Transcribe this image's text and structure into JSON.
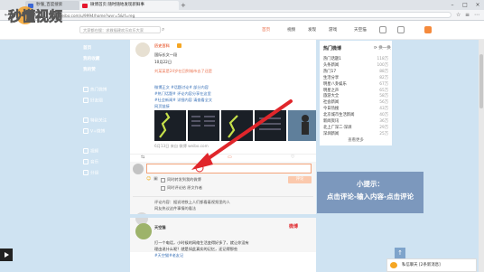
{
  "browser": {
    "tabs": [
      {
        "label": "秒懂_百度搜索"
      },
      {
        "label": "微博首页 随时随地发现新鲜事"
      }
    ],
    "new_tab": "+",
    "url": "weibo.com/u/9994/home?wvr=5&lf=reg"
  },
  "logo": {
    "text": "秒懂视频"
  },
  "site_header": {
    "search_placeholder": "大家都在搜：求救福建欢乐欢乐大家",
    "nav": [
      "首页",
      "视频",
      "发现",
      "游戏"
    ],
    "user": "天空猫"
  },
  "left_nav": [
    {
      "label": "首页",
      "bold": true
    },
    {
      "label": "我的收藏",
      "bold": true
    },
    {
      "label": "我的赞",
      "bold": true
    },
    {
      "label": "热门微博",
      "bold": false
    },
    {
      "label": "好友圈",
      "bold": false
    },
    {
      "label": "特别关注",
      "bold": false
    },
    {
      "label": "V+微博",
      "bold": false
    },
    {
      "label": "视频",
      "bold": false
    },
    {
      "label": "音乐",
      "bold": false
    },
    {
      "label": "分组",
      "bold": false
    }
  ],
  "post": {
    "author": "历史百科",
    "lines": [
      "国际长文一段",
      "10月22日",
      "刘某某是24岁在回到城市去了还是",
      "微博正文 #话题讨论# 部分内容",
      "#热门话题# 评论内容分享在这里",
      "#社会新闻# 详细内容 请查看全文",
      "网页链接"
    ],
    "source": "6月13日 来自 微博 weibo.com"
  },
  "comment": {
    "send_label": "评论",
    "option1": "同时转发到我的微博",
    "option2": "同时评论给 原文作者",
    "sample_lines": [
      "评论内容：据说地铁上人们都看着视频里的人",
      "网友热议这件事情的看法"
    ]
  },
  "post2": {
    "author": "天空猫",
    "lines": [
      "打一个电话，小时候的网络生活变得好多了，就让你没有",
      "理由说什么呢？就是如此真实的记忆，还记得那些",
      "#天空猫#老友记"
    ]
  },
  "hot": {
    "title": "热门微博",
    "more": "查看更多",
    "items": [
      {
        "text": "热门话题1",
        "value": "118万"
      },
      {
        "text": "头条新闻",
        "value": "100万"
      },
      {
        "text": "热门17",
        "value": "88万"
      },
      {
        "text": "生活分享",
        "value": "82万"
      },
      {
        "text": "明星八卦娱乐",
        "value": "67万"
      },
      {
        "text": "明星之声",
        "value": "65万"
      },
      {
        "text": "旅游大全",
        "value": "58万"
      },
      {
        "text": "社会新闻",
        "value": "56万"
      },
      {
        "text": "今日热搜",
        "value": "43万"
      },
      {
        "text": "北京城市生活新闻",
        "value": "40万"
      },
      {
        "text": "新闻资讯",
        "value": "36万"
      },
      {
        "text": "北上广深二·深圳",
        "value": "29万"
      },
      {
        "text": "深圳新闻",
        "value": "25万"
      }
    ]
  },
  "tip": {
    "line1": "小提示：",
    "line2": "点击评论-输入内容-点击评论"
  },
  "message_panel": {
    "label": "私信聊天 [2条新消息]"
  },
  "colors": {
    "accent": "#eb7350",
    "link": "#3a72b8",
    "tip_bg": "#7c98bd",
    "arrow": "#e0262b"
  }
}
